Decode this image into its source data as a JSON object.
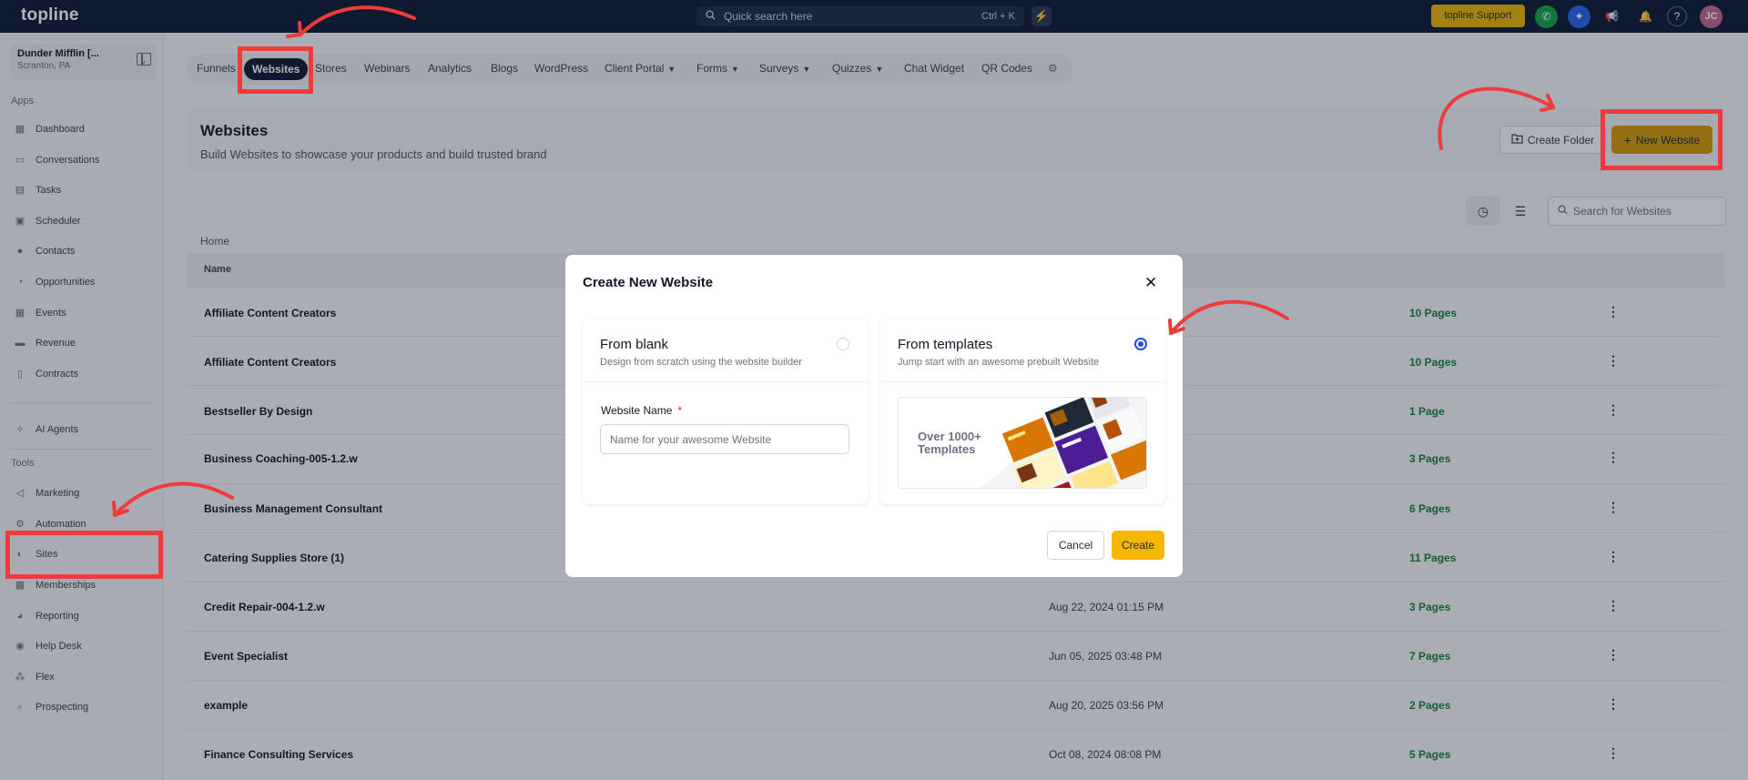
{
  "topbar": {
    "logo": "topline",
    "search_placeholder": "Quick search here",
    "search_shortcut": "Ctrl + K",
    "support_label": "topline Support",
    "avatar_initials": "JC"
  },
  "sidebar": {
    "account_name": "Dunder Mifflin [...",
    "account_location": "Scranton, PA",
    "apps_label": "Apps",
    "tools_label": "Tools",
    "apps": [
      {
        "label": "Dashboard",
        "icon": "dashboard-icon"
      },
      {
        "label": "Conversations",
        "icon": "chat-icon"
      },
      {
        "label": "Tasks",
        "icon": "tasks-icon"
      },
      {
        "label": "Scheduler",
        "icon": "calendar-icon"
      },
      {
        "label": "Contacts",
        "icon": "contacts-icon"
      },
      {
        "label": "Opportunities",
        "icon": "opportunities-icon"
      },
      {
        "label": "Events",
        "icon": "events-icon"
      },
      {
        "label": "Revenue",
        "icon": "revenue-icon"
      },
      {
        "label": "Contracts",
        "icon": "contracts-icon"
      }
    ],
    "ai_agents": "AI Agents",
    "tools": [
      {
        "label": "Marketing",
        "icon": "megaphone-icon"
      },
      {
        "label": "Automation",
        "icon": "automation-icon"
      },
      {
        "label": "Sites",
        "icon": "sites-icon"
      },
      {
        "label": "Memberships",
        "icon": "memberships-icon"
      },
      {
        "label": "Reporting",
        "icon": "reporting-icon"
      },
      {
        "label": "Help Desk",
        "icon": "help-desk-icon"
      },
      {
        "label": "Flex",
        "icon": "flex-icon"
      },
      {
        "label": "Prospecting",
        "icon": "prospecting-icon"
      }
    ]
  },
  "tabs": [
    {
      "label": "Funnels"
    },
    {
      "label": "Websites",
      "active": true
    },
    {
      "label": "Stores"
    },
    {
      "label": "Webinars"
    },
    {
      "label": "Analytics"
    },
    {
      "label": "Blogs"
    },
    {
      "label": "WordPress"
    },
    {
      "label": "Client Portal",
      "dropdown": true
    },
    {
      "label": "Forms",
      "dropdown": true
    },
    {
      "label": "Surveys",
      "dropdown": true
    },
    {
      "label": "Quizzes",
      "dropdown": true
    },
    {
      "label": "Chat Widget"
    },
    {
      "label": "QR Codes"
    }
  ],
  "header": {
    "title": "Websites",
    "subtitle": "Build Websites to showcase your products and build trusted brand",
    "create_folder": "Create Folder",
    "new_website": "New Website"
  },
  "toolbar": {
    "search_placeholder": "Search for Websites"
  },
  "table": {
    "breadcrumb": "Home",
    "col_name": "Name",
    "rows": [
      {
        "name": "Affiliate Content Creators",
        "date": "",
        "pages": "10 Pages"
      },
      {
        "name": "Affiliate Content Creators",
        "date": "",
        "pages": "10 Pages"
      },
      {
        "name": "Bestseller By Design",
        "date": "",
        "pages": "1 Page"
      },
      {
        "name": "Business Coaching-005-1.2.w",
        "date": "",
        "pages": "3 Pages"
      },
      {
        "name": "Business Management Consultant",
        "date": "",
        "pages": "6 Pages"
      },
      {
        "name": "Catering Supplies Store (1)",
        "date": "",
        "pages": "11 Pages"
      },
      {
        "name": "Credit Repair-004-1.2.w",
        "date": "Aug 22, 2024 01:15 PM",
        "pages": "3 Pages"
      },
      {
        "name": "Event Specialist",
        "date": "Jun 05, 2025 03:48 PM",
        "pages": "7 Pages"
      },
      {
        "name": "example",
        "date": "Aug 20, 2025 03:56 PM",
        "pages": "2 Pages"
      },
      {
        "name": "Finance Consulting Services",
        "date": "Oct 08, 2024 08:08 PM",
        "pages": "5 Pages"
      }
    ]
  },
  "modal": {
    "title": "Create New Website",
    "blank_title": "From blank",
    "blank_desc": "Design from scratch using the website builder",
    "templates_title": "From templates",
    "templates_desc": "Jump start with an awesome prebuilt Website",
    "field_label": "Website Name",
    "field_required": "*",
    "field_placeholder": "Name for your awesome Website",
    "templates_badge": "Over 1000+ Templates",
    "cancel": "Cancel",
    "create": "Create",
    "selected": "templates"
  },
  "colors": {
    "topbar": "#101a33",
    "accent_yellow": "#f5b700",
    "pages_green": "#15803d",
    "annotation_red": "#ef3b3b"
  }
}
